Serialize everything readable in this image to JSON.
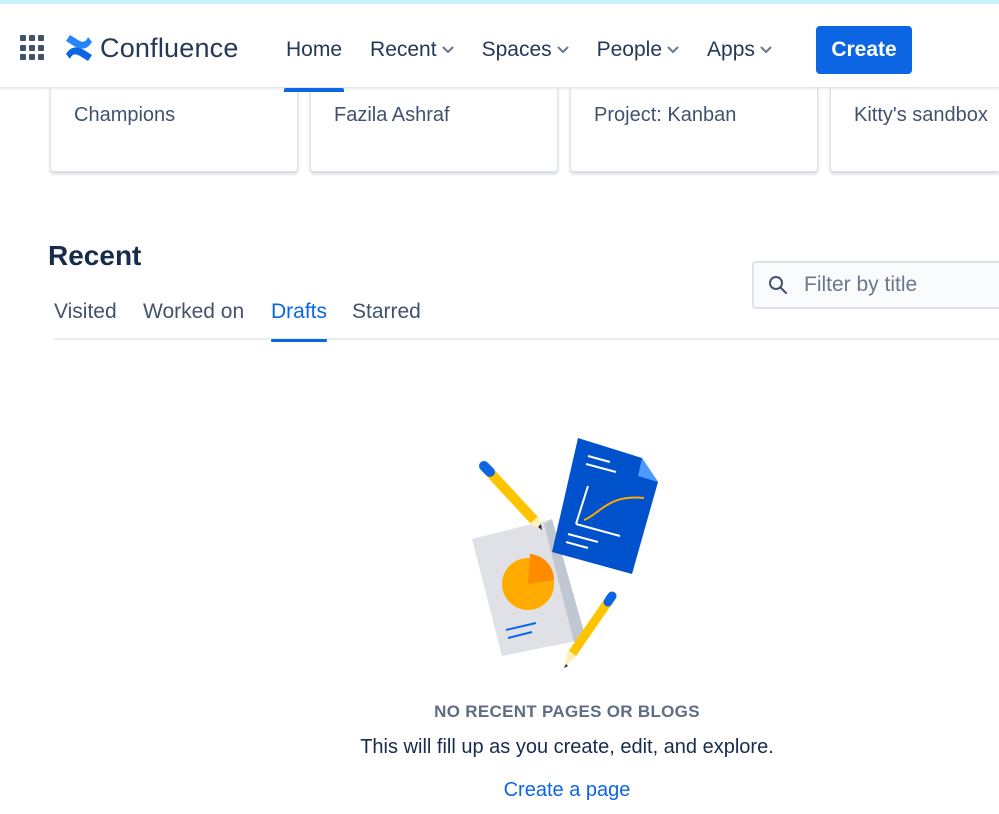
{
  "header": {
    "brand": "Confluence",
    "nav": [
      {
        "label": "Home",
        "active": true,
        "dropdown": false
      },
      {
        "label": "Recent",
        "active": false,
        "dropdown": true
      },
      {
        "label": "Spaces",
        "active": false,
        "dropdown": true
      },
      {
        "label": "People",
        "active": false,
        "dropdown": true
      },
      {
        "label": "Apps",
        "active": false,
        "dropdown": true
      }
    ],
    "create_label": "Create",
    "icons": {
      "app_switcher": "app-grid-icon",
      "logo": "confluence-logo-icon",
      "dropdown": "chevron-down-icon"
    }
  },
  "spaces": {
    "cards": [
      {
        "title": "Champions"
      },
      {
        "title": "Fazila Ashraf"
      },
      {
        "title": "Project: Kanban"
      },
      {
        "title": "Kitty's sandbox"
      }
    ]
  },
  "recent": {
    "title": "Recent",
    "filter_placeholder": "Filter by title",
    "tabs": [
      {
        "label": "Visited",
        "active": false
      },
      {
        "label": "Worked on",
        "active": false
      },
      {
        "label": "Drafts",
        "active": true
      },
      {
        "label": "Starred",
        "active": false
      }
    ]
  },
  "empty_state": {
    "heading": "NO RECENT PAGES OR BLOGS",
    "text": "This will fill up as you create, edit, and explore.",
    "link": "Create a page",
    "illustration": "documents-illustration"
  },
  "colors": {
    "accent": "#0c66e4",
    "text": "#172b4d",
    "subtle": "#42526e",
    "illustration_blue": "#0052cc",
    "illustration_yellow": "#ffc400",
    "illustration_orange": "#ff8b00"
  }
}
